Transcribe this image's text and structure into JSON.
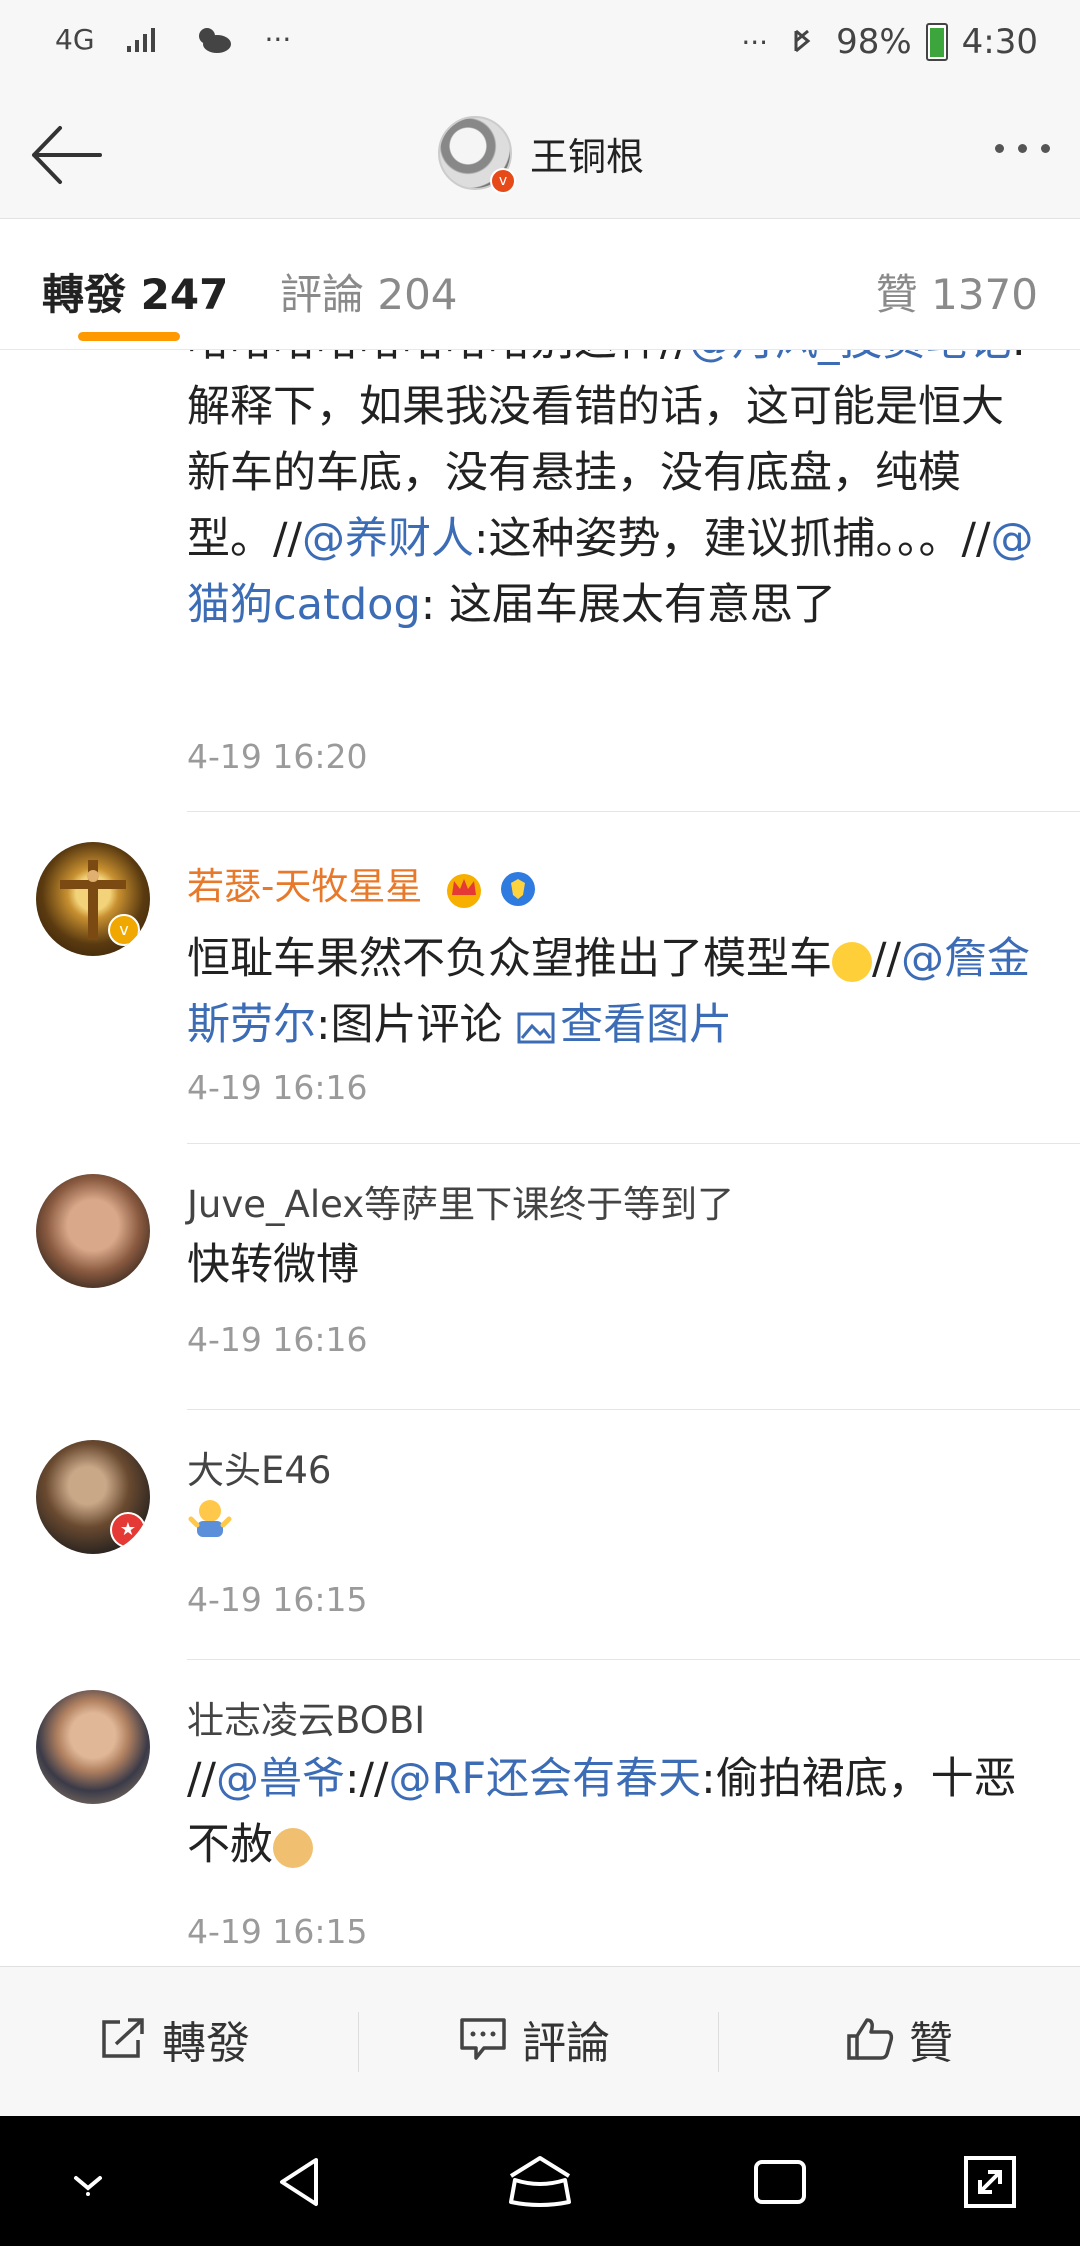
{
  "status": {
    "network": "4G",
    "dots_left": "···",
    "dots_right": "···",
    "battery": "98%",
    "time": "4:30"
  },
  "header": {
    "title": "王铜根"
  },
  "tabs": {
    "repost": "轉發 247",
    "comment": "評論 204",
    "like": "贊 1370"
  },
  "entries": [
    {
      "body_parts": [
        "哈哈哈哈哈哈哈哈别这样//",
        "@月风_投资笔记",
        ":解释下，如果我没看错的话，这可能是恒大新车的车底，没有悬挂，没有底盘，纯模型。//",
        "@养财人",
        ":这种姿势，建议抓捕。。。//",
        "@猫狗catdog",
        ": 这届车展太有意思了"
      ],
      "time": "4-19 16:20"
    },
    {
      "name": "若瑟-天牧星星",
      "body_parts": [
        "恒耻车果然不负众望推出了模型车",
        "//",
        "@詹金斯劳尔",
        ":图片评论 ",
        "查看图片"
      ],
      "time": "4-19 16:16"
    },
    {
      "name": "Juve_Alex等萨里下课终于等到了",
      "body": "快转微博",
      "time": "4-19 16:16"
    },
    {
      "name": "大头E46",
      "time": "4-19 16:15"
    },
    {
      "name": "壮志凌云BOBI",
      "body_parts": [
        "//",
        "@兽爷",
        "://",
        "@RF还会有春天",
        ":偷拍裙底，十恶不赦"
      ],
      "time": "4-19 16:15"
    }
  ],
  "toolbar": {
    "repost": "轉發",
    "comment": "評論",
    "like": "贊"
  },
  "colors": {
    "accent_orange": "#ff9900",
    "link_blue": "#3b6cb5",
    "vip_name_orange": "#e8792a"
  },
  "icons": [
    "back-arrow-icon",
    "more-dots-icon",
    "verified-icon",
    "crown-icon",
    "shield-icon",
    "image-icon",
    "repost-icon",
    "comment-icon",
    "like-icon",
    "emoji-icon"
  ]
}
